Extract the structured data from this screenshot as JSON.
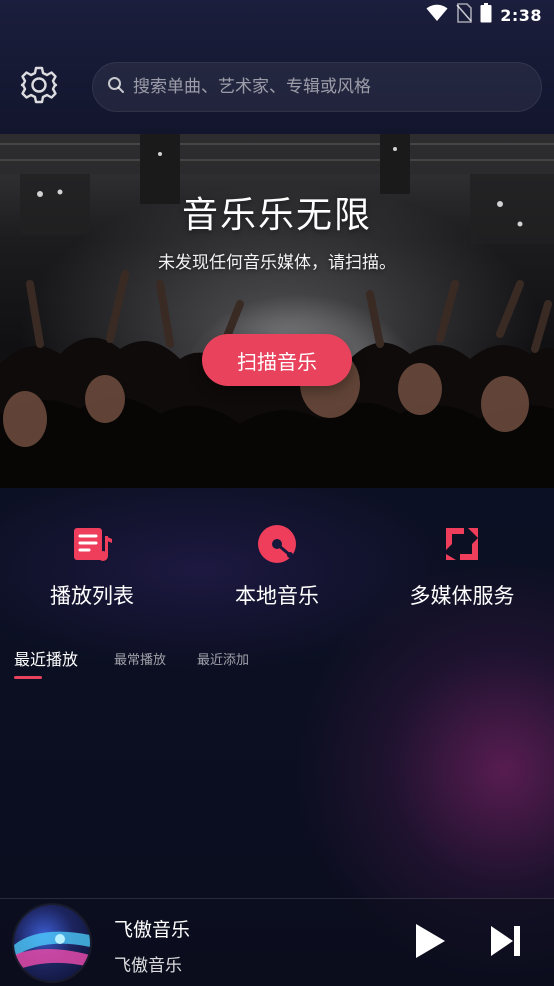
{
  "status_bar": {
    "time": "2:38",
    "icons": [
      "wifi-icon",
      "no-sim-icon",
      "battery-icon"
    ]
  },
  "header": {
    "settings_icon": "gear-icon",
    "search": {
      "icon": "search-icon",
      "placeholder": "搜索单曲、艺术家、专辑或风格",
      "value": ""
    }
  },
  "banner": {
    "title": "音乐乐无限",
    "subtitle": "未发现任何音乐媒体，请扫描。",
    "button_label": "扫描音乐"
  },
  "features": [
    {
      "label": "播放列表",
      "icon": "playlist-icon"
    },
    {
      "label": "本地音乐",
      "icon": "disc-icon"
    },
    {
      "label": "多媒体服务",
      "icon": "media-service-icon"
    }
  ],
  "tabs": [
    {
      "label": "最近播放",
      "active": true
    },
    {
      "label": "最常播放",
      "active": false
    },
    {
      "label": "最近添加",
      "active": false
    }
  ],
  "player": {
    "title": "飞傲音乐",
    "artist": "飞傲音乐",
    "controls": [
      "play-icon",
      "skip-next-icon"
    ]
  },
  "colors": {
    "accent": "#e8425c",
    "background_top": "#1b1e3c",
    "background_bottom": "#0a0d1e"
  }
}
